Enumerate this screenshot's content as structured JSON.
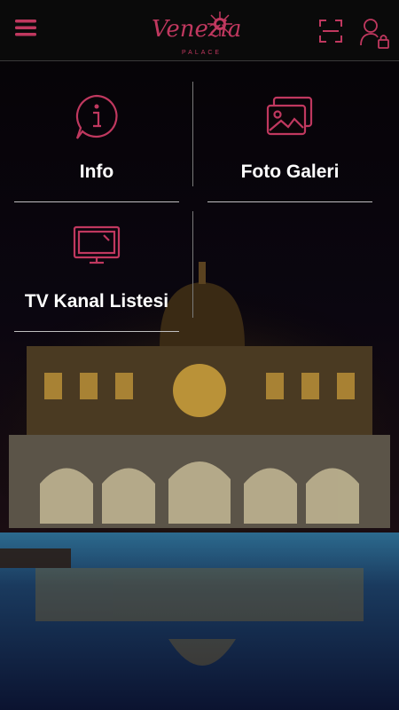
{
  "header": {
    "menu_icon": "hamburger-menu-icon",
    "logo_text": "Venezia",
    "logo_subtext": "PALACE",
    "scan_icon": "qr-scan-icon",
    "user_icon": "user-lock-icon"
  },
  "tiles": [
    {
      "label": "Info",
      "icon": "info-bubble-icon"
    },
    {
      "label": "Foto Galeri",
      "icon": "photo-gallery-icon"
    },
    {
      "label": "TV Kanal Listesi",
      "icon": "tv-icon"
    }
  ],
  "colors": {
    "accent": "#c0385f",
    "header_bg": "#0a0a0a",
    "divider": "#bfbfbf"
  }
}
